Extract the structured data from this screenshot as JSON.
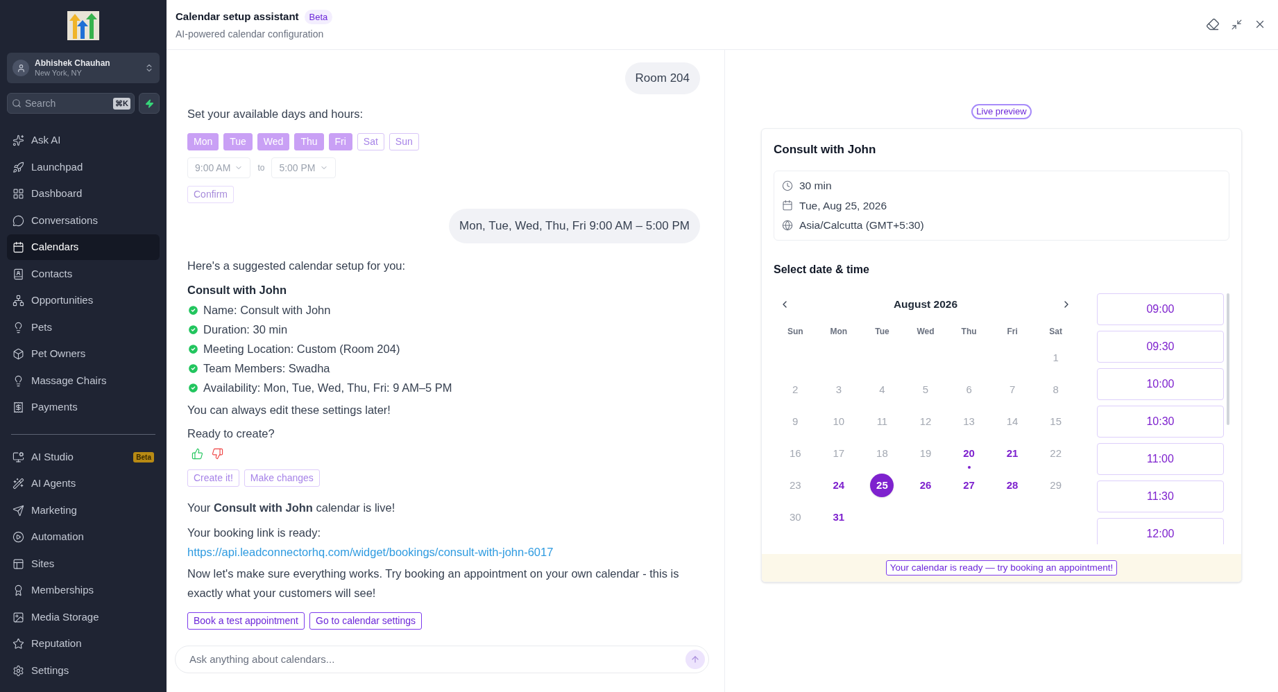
{
  "sidebar": {
    "account": {
      "name": "Abhishek Chauhan",
      "location": "New York, NY"
    },
    "search": {
      "placeholder": "Search",
      "shortcut": "⌘K"
    },
    "groups": [
      [
        {
          "label": "Ask AI",
          "selected": false
        },
        {
          "label": "Launchpad",
          "selected": false
        },
        {
          "label": "Dashboard",
          "selected": false
        },
        {
          "label": "Conversations",
          "selected": false
        },
        {
          "label": "Calendars",
          "selected": true
        },
        {
          "label": "Contacts",
          "selected": false
        },
        {
          "label": "Opportunities",
          "selected": false
        },
        {
          "label": "Pets",
          "selected": false
        },
        {
          "label": "Pet Owners",
          "selected": false
        },
        {
          "label": "Massage Chairs",
          "selected": false
        },
        {
          "label": "Payments",
          "selected": false
        }
      ],
      [
        {
          "label": "AI Studio",
          "selected": false,
          "badge": "Beta"
        },
        {
          "label": "AI Agents",
          "selected": false
        },
        {
          "label": "Marketing",
          "selected": false
        },
        {
          "label": "Automation",
          "selected": false
        },
        {
          "label": "Sites",
          "selected": false
        },
        {
          "label": "Memberships",
          "selected": false
        },
        {
          "label": "Media Storage",
          "selected": false
        },
        {
          "label": "Reputation",
          "selected": false
        },
        {
          "label": "Settings",
          "selected": false
        }
      ]
    ]
  },
  "header": {
    "title": "Calendar setup assistant",
    "badge": "Beta",
    "subtitle": "AI-powered calendar configuration"
  },
  "chat": {
    "user_reply_1": "Room 204",
    "availability_prompt": "Set your available days and hours:",
    "days": [
      {
        "label": "Mon",
        "selected": true
      },
      {
        "label": "Tue",
        "selected": true
      },
      {
        "label": "Wed",
        "selected": true
      },
      {
        "label": "Thu",
        "selected": true
      },
      {
        "label": "Fri",
        "selected": true
      },
      {
        "label": "Sat",
        "selected": false
      },
      {
        "label": "Sun",
        "selected": false
      }
    ],
    "start_time": "9:00 AM",
    "to_label": "to",
    "end_time": "5:00 PM",
    "confirm": {
      "label": "Confirm",
      "disabled": true
    },
    "user_reply_2": "Mon, Tue, Wed, Thu, Fri 9:00 AM – 5:00 PM",
    "suggestion_intro": "Here's a suggested calendar setup for you:",
    "suggestion_title": "Consult with John",
    "checklist": [
      "Name: Consult with John",
      "Duration: 30 min",
      "Meeting Location: Custom (Room 204)",
      "Team Members: Swadha",
      "Availability: Mon, Tue, Wed, Thu, Fri: 9 AM–5 PM"
    ],
    "edit_note": "You can always edit these settings later!",
    "ready_question": "Ready to create?",
    "choice_buttons": [
      {
        "label": "Create it!",
        "disabled": true
      },
      {
        "label": "Make changes",
        "disabled": true
      }
    ],
    "live_message": "Your **Consult with John** calendar is live!",
    "link_intro": "Your booking link is ready:",
    "link": "https://api.leadconnectorhq.com/widget/bookings/consult-with-john-6017",
    "test_message": "Now let's make sure everything works. Try booking an appointment on your own calendar - this is exactly what your customers will see!",
    "action_buttons": [
      {
        "label": "Book a test appointment",
        "disabled": false
      },
      {
        "label": "Go to calendar settings",
        "disabled": false
      }
    ],
    "input_placeholder": "Ask anything about calendars..."
  },
  "preview": {
    "badge": "Live preview",
    "title": "Consult with John",
    "details": [
      {
        "kind": "duration",
        "text": "30 min"
      },
      {
        "kind": "date",
        "text": "Tue, Aug 25, 2026"
      },
      {
        "kind": "timezone",
        "text": "Asia/Calcutta (GMT+5:30)"
      }
    ],
    "section_title": "Select date & time",
    "month": "August 2026",
    "weekdays": [
      "Sun",
      "Mon",
      "Tue",
      "Wed",
      "Thu",
      "Fri",
      "Sat"
    ],
    "weeks": [
      [
        {
          "kind": "blank"
        },
        {
          "kind": "blank"
        },
        {
          "kind": "blank"
        },
        {
          "kind": "blank"
        },
        {
          "kind": "blank"
        },
        {
          "kind": "blank"
        },
        {
          "kind": "day",
          "label": "1",
          "available": false,
          "selected": false,
          "marked": false
        }
      ],
      [
        {
          "kind": "day",
          "label": "2",
          "available": false,
          "selected": false,
          "marked": false
        },
        {
          "kind": "day",
          "label": "3",
          "available": false,
          "selected": false,
          "marked": false
        },
        {
          "kind": "day",
          "label": "4",
          "available": false,
          "selected": false,
          "marked": false
        },
        {
          "kind": "day",
          "label": "5",
          "available": false,
          "selected": false,
          "marked": false
        },
        {
          "kind": "day",
          "label": "6",
          "available": false,
          "selected": false,
          "marked": false
        },
        {
          "kind": "day",
          "label": "7",
          "available": false,
          "selected": false,
          "marked": false
        },
        {
          "kind": "day",
          "label": "8",
          "available": false,
          "selected": false,
          "marked": false
        }
      ],
      [
        {
          "kind": "day",
          "label": "9",
          "available": false,
          "selected": false,
          "marked": false
        },
        {
          "kind": "day",
          "label": "10",
          "available": false,
          "selected": false,
          "marked": false
        },
        {
          "kind": "day",
          "label": "11",
          "available": false,
          "selected": false,
          "marked": false
        },
        {
          "kind": "day",
          "label": "12",
          "available": false,
          "selected": false,
          "marked": false
        },
        {
          "kind": "day",
          "label": "13",
          "available": false,
          "selected": false,
          "marked": false
        },
        {
          "kind": "day",
          "label": "14",
          "available": false,
          "selected": false,
          "marked": false
        },
        {
          "kind": "day",
          "label": "15",
          "available": false,
          "selected": false,
          "marked": false
        }
      ],
      [
        {
          "kind": "day",
          "label": "16",
          "available": false,
          "selected": false,
          "marked": false
        },
        {
          "kind": "day",
          "label": "17",
          "available": false,
          "selected": false,
          "marked": false
        },
        {
          "kind": "day",
          "label": "18",
          "available": false,
          "selected": false,
          "marked": false
        },
        {
          "kind": "day",
          "label": "19",
          "available": false,
          "selected": false,
          "marked": false
        },
        {
          "kind": "day",
          "label": "20",
          "available": true,
          "selected": false,
          "marked": true
        },
        {
          "kind": "day",
          "label": "21",
          "available": true,
          "selected": false,
          "marked": false
        },
        {
          "kind": "day",
          "label": "22",
          "available": false,
          "selected": false,
          "marked": false
        }
      ],
      [
        {
          "kind": "day",
          "label": "23",
          "available": false,
          "selected": false,
          "marked": false
        },
        {
          "kind": "day",
          "label": "24",
          "available": true,
          "selected": false,
          "marked": false
        },
        {
          "kind": "day",
          "label": "25",
          "available": true,
          "selected": true,
          "marked": false
        },
        {
          "kind": "day",
          "label": "26",
          "available": true,
          "selected": false,
          "marked": false
        },
        {
          "kind": "day",
          "label": "27",
          "available": true,
          "selected": false,
          "marked": false
        },
        {
          "kind": "day",
          "label": "28",
          "available": true,
          "selected": false,
          "marked": false
        },
        {
          "kind": "day",
          "label": "29",
          "available": false,
          "selected": false,
          "marked": false
        }
      ],
      [
        {
          "kind": "day",
          "label": "30",
          "available": false,
          "selected": false,
          "marked": false
        },
        {
          "kind": "day",
          "label": "31",
          "available": true,
          "selected": false,
          "marked": false
        },
        {
          "kind": "blank"
        },
        {
          "kind": "blank"
        },
        {
          "kind": "blank"
        },
        {
          "kind": "blank"
        },
        {
          "kind": "blank"
        }
      ]
    ],
    "slots": [
      "09:00",
      "09:30",
      "10:00",
      "10:30",
      "11:00",
      "11:30",
      "12:00"
    ],
    "footer": "Your calendar is ready — try booking an appointment!"
  }
}
